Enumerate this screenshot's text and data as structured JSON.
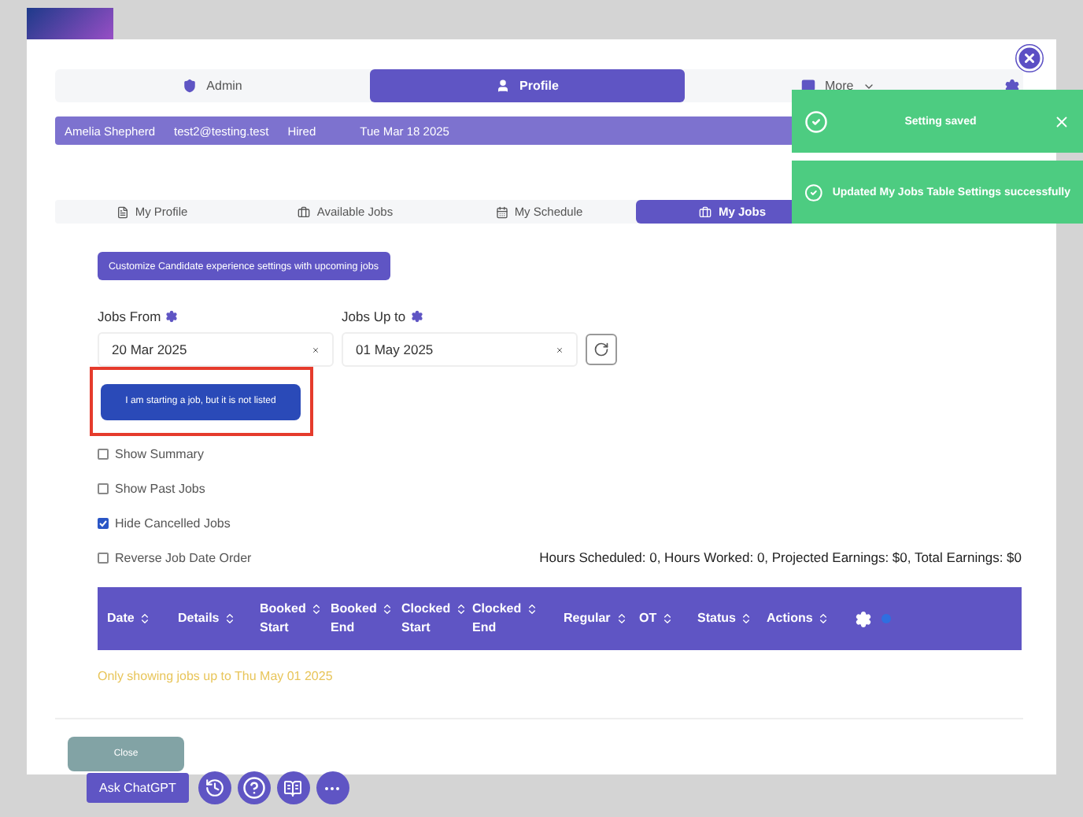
{
  "main_tabs": [
    {
      "label": "Admin",
      "selected": false
    },
    {
      "label": "Profile",
      "selected": true
    },
    {
      "label": "More",
      "selected": false
    }
  ],
  "info_bar": [
    "Amelia Shepherd",
    "test2@testing.test",
    "Hired",
    "Tue Mar 18 2025"
  ],
  "sub_tabs": [
    {
      "label": "My Profile",
      "selected": false
    },
    {
      "label": "Available Jobs",
      "selected": false
    },
    {
      "label": "My Schedule",
      "selected": false
    },
    {
      "label": "My Jobs",
      "selected": true
    }
  ],
  "customize_button": "Customize Candidate experience settings with upcoming jobs",
  "date_fields": [
    {
      "label": "Jobs From",
      "value": "20 Mar 2025"
    },
    {
      "label": "Jobs Up to",
      "value": "01 May 2025"
    }
  ],
  "unlisted_job_button": "I am starting a job, but it is not listed",
  "options": [
    {
      "label": "Show Summary",
      "checked": false
    },
    {
      "label": "Show Past Jobs",
      "checked": false
    },
    {
      "label": "Hide Cancelled Jobs",
      "checked": true
    },
    {
      "label": "Reverse Job Date Order",
      "checked": false
    }
  ],
  "summary": "Hours Scheduled: 0, Hours Worked: 0, Projected Earnings: $0, Total Earnings: $0",
  "table": {
    "columns": [
      [
        "Date"
      ],
      [
        "Details"
      ],
      [
        "Booked",
        "Start"
      ],
      [
        "Booked",
        "End"
      ],
      [
        "Clocked",
        "Start"
      ],
      [
        "Clocked",
        "End"
      ],
      [
        "Regular"
      ],
      [
        "OT"
      ],
      [
        "Status"
      ],
      [
        "Actions"
      ]
    ]
  },
  "notice": "Only showing jobs up to Thu May 01 2025",
  "close_button": "Close",
  "assistant_button": "Ask ChatGPT",
  "toasts": [
    {
      "message": "Setting saved",
      "closable": true
    },
    {
      "message": "Updated My Jobs Table Settings successfully",
      "closable": false
    }
  ]
}
